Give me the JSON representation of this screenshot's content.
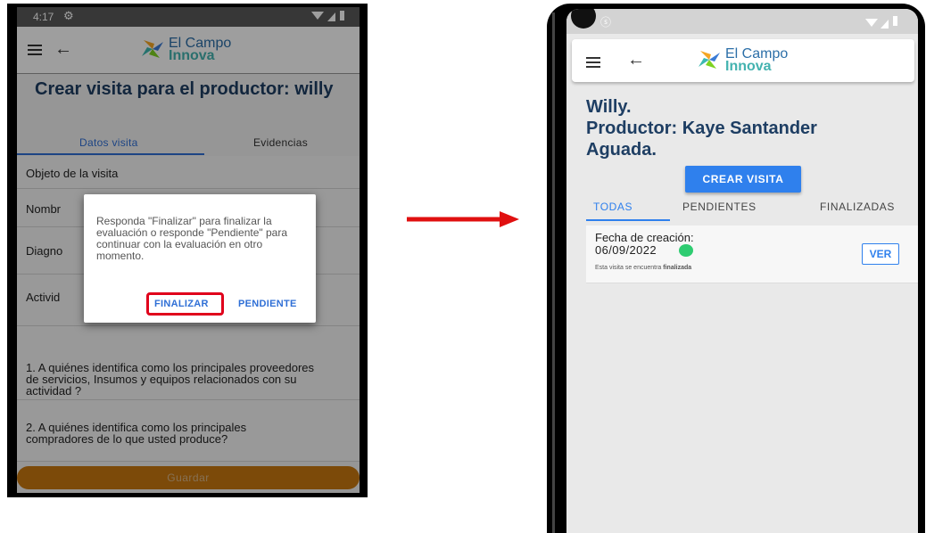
{
  "left_phone": {
    "status": {
      "time": "4:17"
    },
    "logo": {
      "line1": "El Campo",
      "line2": "Innova"
    },
    "heading": "Crear visita para el productor: willy",
    "tabs": [
      {
        "label": "Datos visita",
        "active": true
      },
      {
        "label": "Evidencias",
        "active": false
      }
    ],
    "form": {
      "objeto": "Objeto de la visita",
      "nombre": "Nombr",
      "diagnostico": "Diagno",
      "actividad": "Activid",
      "q1": "1. A quiénes identifica como los principales proveedores de servicios, Insumos y equipos relacionados con su actividad ?",
      "q2": "2. A quiénes identifica como los principales compradores de lo que usted produce?"
    },
    "dialog": {
      "message": "Responda \"Finalizar\" para finalizar la evaluación o responde \"Pendiente\" para continuar con la evaluación en otro momento.",
      "finalizar": "FINALIZAR",
      "pendiente": "PENDIENTE"
    },
    "save_label": "Guardar"
  },
  "right_phone": {
    "logo": {
      "line1": "El Campo",
      "line2": "Innova"
    },
    "heading": {
      "line1": "Willy.",
      "line2": "Productor: Kaye Santander",
      "line3": "Aguada."
    },
    "create_label": "CREAR VISITA",
    "tabs": [
      {
        "label": "TODAS",
        "active": true
      },
      {
        "label": "PENDIENTES",
        "active": false
      },
      {
        "label": "FINALIZADAS",
        "active": false
      }
    ],
    "card": {
      "date_label": "Fecha de creación:",
      "date": "06/09/2022",
      "status_color": "#2ecc71",
      "note_prefix": "Esta visita se encuentra ",
      "note_status": "finalizada",
      "ver_label": "VER"
    }
  },
  "colors": {
    "accent_blue": "#2f80ed",
    "heading_navy": "#1e3e63",
    "highlight_red": "#e0001b",
    "arrow_red": "#e01010",
    "save_orange": "#c87810"
  }
}
